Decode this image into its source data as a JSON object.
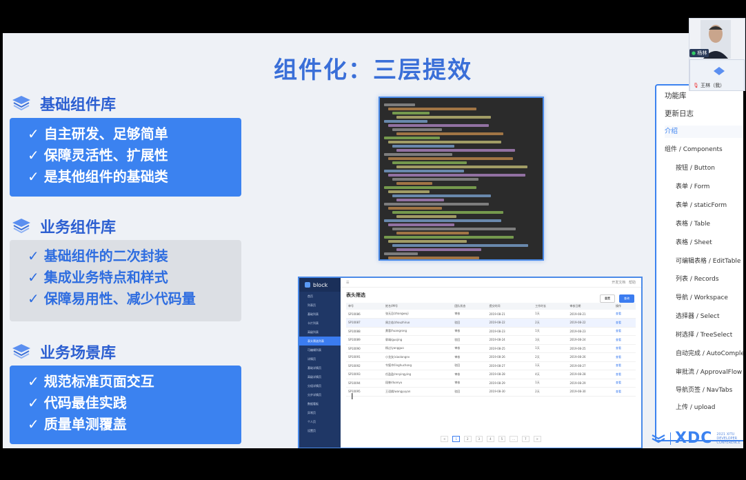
{
  "slide": {
    "title": "组件化：三层提效",
    "sections": [
      {
        "heading": "基础组件库",
        "style": "blue",
        "items": [
          "✓ 自主研发、足够简单",
          "✓ 保障灵活性、扩展性",
          "✓ 是其他组件的基础类"
        ]
      },
      {
        "heading": "业务组件库",
        "style": "gray",
        "items": [
          "✓ 基础组件的二次封装",
          "✓ 集成业务特点和样式",
          "✓ 保障易用性、减少代码量"
        ]
      },
      {
        "heading": "业务场景库",
        "style": "blue",
        "items": [
          "✓ 规范标准页面交互",
          "✓ 代码最佳实践",
          "✓ 质量单测覆盖"
        ]
      }
    ]
  },
  "app_screenshot": {
    "logo": "block",
    "page_title": "表头筛选",
    "top_right": [
      "开发文档",
      "帮助"
    ],
    "buttons": [
      "重置",
      "查询"
    ],
    "nav": [
      "首页",
      "列表页",
      "基础列表",
      "卡片列表",
      "高级列表",
      "表头筛选列表",
      "可编辑列表",
      "详情页",
      "基础详情页",
      "高级详情页",
      "分组详情页",
      "分步详情页",
      "数据看板",
      "异常页",
      "个人页",
      "设置页"
    ],
    "active_nav": "表头筛选列表",
    "columns": [
      "单号",
      "姓名/IM号",
      "团队状态",
      "提交时间",
      "工作时长",
      "审核日期",
      "操作"
    ],
    "rows": [
      [
        "SP10086",
        "张无忌/zhangwuji",
        "审核",
        "2019-08-21",
        "1天",
        "2019-08-21",
        "查看"
      ],
      [
        "SP10087",
        "周芷若/zhouzhiruo",
        "驳回",
        "2019-08-22",
        "2天",
        "2019-08-22",
        "查看"
      ],
      [
        "SP10088",
        "黄蓉/huangrong",
        "审核",
        "2019-08-23",
        "1天",
        "2019-08-23",
        "查看"
      ],
      [
        "SP10089",
        "郭靖/guojing",
        "驳回",
        "2019-08-24",
        "3天",
        "2019-08-24",
        "查看"
      ],
      [
        "SP10090",
        "杨过/yangguo",
        "审核",
        "2019-08-25",
        "1天",
        "2019-08-25",
        "查看"
      ],
      [
        "SP10091",
        "小龙女/xiaolongnv",
        "审核",
        "2019-08-26",
        "2天",
        "2019-08-26",
        "查看"
      ],
      [
        "SP10092",
        "令狐冲/linghuchong",
        "驳回",
        "2019-08-27",
        "1天",
        "2019-08-27",
        "查看"
      ],
      [
        "SP10093",
        "任盈盈/renyingying",
        "审核",
        "2019-08-28",
        "4天",
        "2019-08-28",
        "查看"
      ],
      [
        "SP10094",
        "段誉/duanyu",
        "审核",
        "2019-08-29",
        "1天",
        "2019-08-29",
        "查看"
      ],
      [
        "SP10095",
        "王语嫣/wangyuyan",
        "驳回",
        "2019-08-30",
        "2天",
        "2019-08-30",
        "查看"
      ]
    ],
    "pager": [
      "<",
      "1",
      "2",
      "3",
      "4",
      "5",
      "...",
      "7",
      ">"
    ]
  },
  "menu": {
    "items": [
      {
        "label": "功能库",
        "type": "head"
      },
      {
        "label": "更新日志",
        "type": "head"
      },
      {
        "label": "介绍",
        "type": "link"
      },
      {
        "label": "组件 / Components",
        "type": "group"
      },
      {
        "label": "按钮 / Button",
        "type": "item"
      },
      {
        "label": "表单 / Form",
        "type": "item"
      },
      {
        "label": "表单 / staticForm",
        "type": "item"
      },
      {
        "label": "表格 / Table",
        "type": "item"
      },
      {
        "label": "表格 / Sheet",
        "type": "item"
      },
      {
        "label": "可编辑表格 / EditTable",
        "type": "item"
      },
      {
        "label": "列表 / Records",
        "type": "item"
      },
      {
        "label": "导航 / Workspace",
        "type": "item"
      },
      {
        "label": "选择器 / Select",
        "type": "item"
      },
      {
        "label": "树选择 / TreeSelect",
        "type": "item"
      },
      {
        "label": "自动完成 / AutoComplete",
        "type": "item"
      },
      {
        "label": "审批流 / ApprovalFlow",
        "type": "item"
      },
      {
        "label": "导航页签 / NavTabs",
        "type": "item"
      },
      {
        "label": "上传 / upload",
        "type": "item"
      }
    ]
  },
  "video": {
    "speaker_tag": "杨林",
    "second_participant": "王林（我）"
  },
  "branding": {
    "logo": "XDC",
    "sub": [
      "2021 XITU",
      "DEVELOPER",
      "CONFERENCE"
    ]
  },
  "colors": {
    "accent": "#3b82f0",
    "title": "#3a6fd8",
    "gray_box": "#dcdfe4"
  }
}
